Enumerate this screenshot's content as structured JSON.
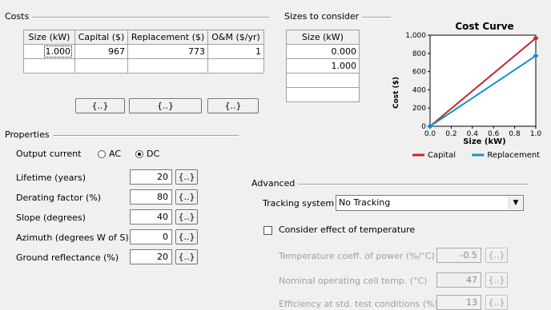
{
  "costs": {
    "title": "Costs",
    "headers": [
      "Size (kW)",
      "Capital ($)",
      "Replacement ($)",
      "O&M ($/yr)"
    ],
    "rows": [
      [
        "1.000",
        "967",
        "773",
        "1"
      ]
    ],
    "buttons": [
      "{..}",
      "{..}",
      "{..}"
    ]
  },
  "sizes": {
    "title": "Sizes to consider",
    "header": "Size (kW)",
    "rows": [
      "0.000",
      "1.000"
    ]
  },
  "chart_data": {
    "type": "line",
    "title": "Cost Curve",
    "xlabel": "Size (kW)",
    "ylabel": "Cost ($)",
    "xlim": [
      0.0,
      1.0
    ],
    "ylim": [
      0,
      1000
    ],
    "xticks": [
      "0.0",
      "0.2",
      "0.4",
      "0.6",
      "0.8",
      "1.0"
    ],
    "yticks": [
      "0",
      "200",
      "400",
      "600",
      "800",
      "1,000"
    ],
    "legend_position": "bottom",
    "series": [
      {
        "name": "Capital",
        "color": "#c0282d",
        "x": [
          0.0,
          1.0
        ],
        "y": [
          0,
          967
        ]
      },
      {
        "name": "Replacement",
        "color": "#1b8fc9",
        "x": [
          0.0,
          1.0
        ],
        "y": [
          0,
          773
        ]
      }
    ]
  },
  "properties": {
    "title": "Properties",
    "output_current": {
      "label": "Output current",
      "options": [
        "AC",
        "DC"
      ],
      "selected": "DC"
    },
    "fields": [
      {
        "label": "Lifetime (years)",
        "value": "20",
        "button": "{..}"
      },
      {
        "label": "Derating factor (%)",
        "value": "80",
        "button": "{..}"
      },
      {
        "label": "Slope (degrees)",
        "value": "40",
        "button": "{..}"
      },
      {
        "label": "Azimuth (degrees W of S)",
        "value": "0",
        "button": "{..}"
      },
      {
        "label": "Ground reflectance (%)",
        "value": "20",
        "button": "{..}"
      }
    ]
  },
  "advanced": {
    "title": "Advanced",
    "tracking_label": "Tracking system",
    "tracking_value": "No Tracking",
    "temp_checkbox_label": "Consider effect of temperature",
    "temp_fields": [
      {
        "label": "Temperature coeff. of power (%/°C)",
        "value": "-0.5",
        "button": "{..}"
      },
      {
        "label": "Nominal operating cell temp. (°C)",
        "value": "47",
        "button": "{..}"
      },
      {
        "label": "Efficiency at std. test conditions (%)",
        "value": "13",
        "button": "{..}"
      }
    ]
  }
}
